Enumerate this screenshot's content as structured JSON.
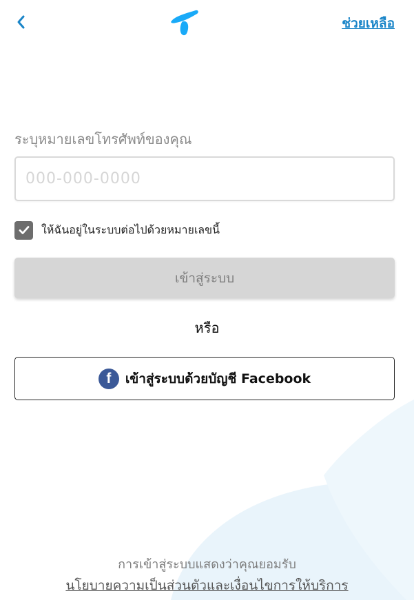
{
  "colors": {
    "brand_blue": "#1a85c8",
    "facebook_blue": "#3b5998",
    "disabled_button": "#d6d6d6",
    "checkbox": "#6d6d6d"
  },
  "header": {
    "back_icon": "chevron-left-icon",
    "logo_icon": "telenor-logo-icon",
    "help_label": "ช่วยเหลือ"
  },
  "form": {
    "phone_label": "ระบุหมายเลขโทรศัพท์ของคุณ",
    "phone_placeholder": "000-000-0000",
    "phone_value": "",
    "remember_checked": true,
    "remember_label": "ให้ฉันอยู่ในระบบต่อไปด้วยหมายเลขนี้",
    "login_label": "เข้าสู่ระบบ"
  },
  "divider": {
    "or_label": "หรือ"
  },
  "social": {
    "facebook_icon": "facebook-icon",
    "facebook_glyph": "f",
    "facebook_label": "เข้าสู่ระบบด้วยบัญชี Facebook"
  },
  "footer": {
    "consent_text": "การเข้าสู่ระบบแสดงว่าคุณยอมรับ",
    "policy_link": "นโยบายความเป็นส่วนตัวและเงื่อนไขการให้บริการ"
  }
}
